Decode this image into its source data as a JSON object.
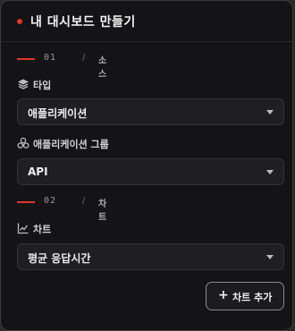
{
  "header": {
    "title": "내 대시보드 만들기"
  },
  "sections": [
    {
      "number": "01",
      "separator": "/",
      "name": "소스"
    },
    {
      "number": "02",
      "separator": "/",
      "name": "차트"
    }
  ],
  "fields": {
    "type": {
      "label": "타입",
      "icon": "layers-icon",
      "value": "애플리케이션"
    },
    "app_group": {
      "label": "애플리케이션 그룹",
      "icon": "app-group-icon",
      "value": "API"
    },
    "chart": {
      "label": "차트",
      "icon": "line-chart-icon",
      "value": "평균 응답시간"
    }
  },
  "actions": {
    "add_chart_icon": "+",
    "add_chart_label": "차트 추가"
  },
  "colors": {
    "accent": "#e0342c",
    "panel_bg": "#141416",
    "select_bg": "#1f1f22"
  }
}
